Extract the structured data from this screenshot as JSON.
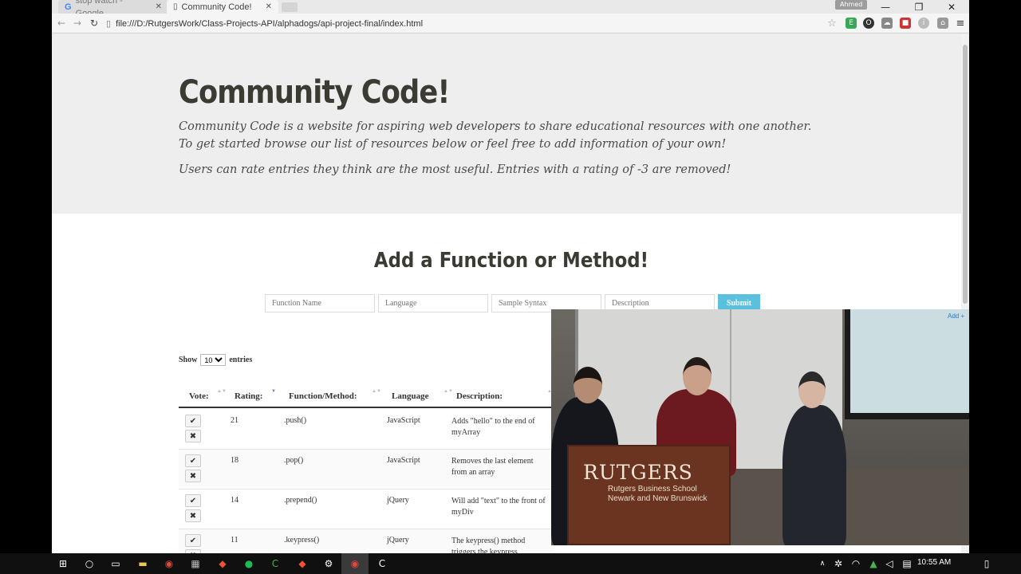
{
  "browser": {
    "tabs": [
      {
        "label": "stop watch - Google",
        "active": false
      },
      {
        "label": "Community Code!",
        "active": true
      }
    ],
    "user_badge": "Ahmed",
    "url": "file:///D:/RutgersWork/Class-Projects-API/alphadogs/api-project-final/index.html",
    "window_controls": [
      "minimize",
      "restore",
      "close"
    ]
  },
  "page": {
    "title": "Community Code!",
    "intro": "Community Code is a website for aspiring web developers to share educational resources with one another. To get started browse our list of resources below or feel free to add information of your own!",
    "rating_note": "Users can rate entries they think are the most useful. Entries with a rating of -3 are removed!",
    "form": {
      "heading": "Add a Function or Method!",
      "placeholders": {
        "function_name": "Function Name",
        "language": "Language",
        "sample_syntax": "Sample Syntax",
        "description": "Description"
      },
      "submit_label": "Submit"
    },
    "show_entries": {
      "prefix": "Show",
      "value": "10",
      "suffix": "entries"
    },
    "table": {
      "headers": [
        "Vote:",
        "Rating:",
        "Function/Method:",
        "Language",
        "Description:"
      ],
      "rows": [
        {
          "rating": "21",
          "function": ".push()",
          "language": "JavaScript",
          "description": "Adds \"hello\" to the end of myArray"
        },
        {
          "rating": "18",
          "function": ".pop()",
          "language": "JavaScript",
          "description": "Removes the last element from an array"
        },
        {
          "rating": "14",
          "function": ".prepend()",
          "language": "jQuery",
          "description": "Will add \"text\" to the front of myDiv"
        },
        {
          "rating": "11",
          "function": ".keypress()",
          "language": "jQuery",
          "description": "The keypress() method triggers the keypress"
        }
      ]
    }
  },
  "video": {
    "podium_name": "RUTGERS",
    "podium_sub_line1": "Rutgers Business School",
    "podium_sub_line2": "Newark and New Brunswick",
    "screen_text": "Add +"
  },
  "taskbar": {
    "clock": "10:55 AM"
  },
  "colors": {
    "accent_submit": "#5bc0de",
    "jumbotron_bg": "#eeeeee",
    "heading_text": "#3b3b33"
  }
}
